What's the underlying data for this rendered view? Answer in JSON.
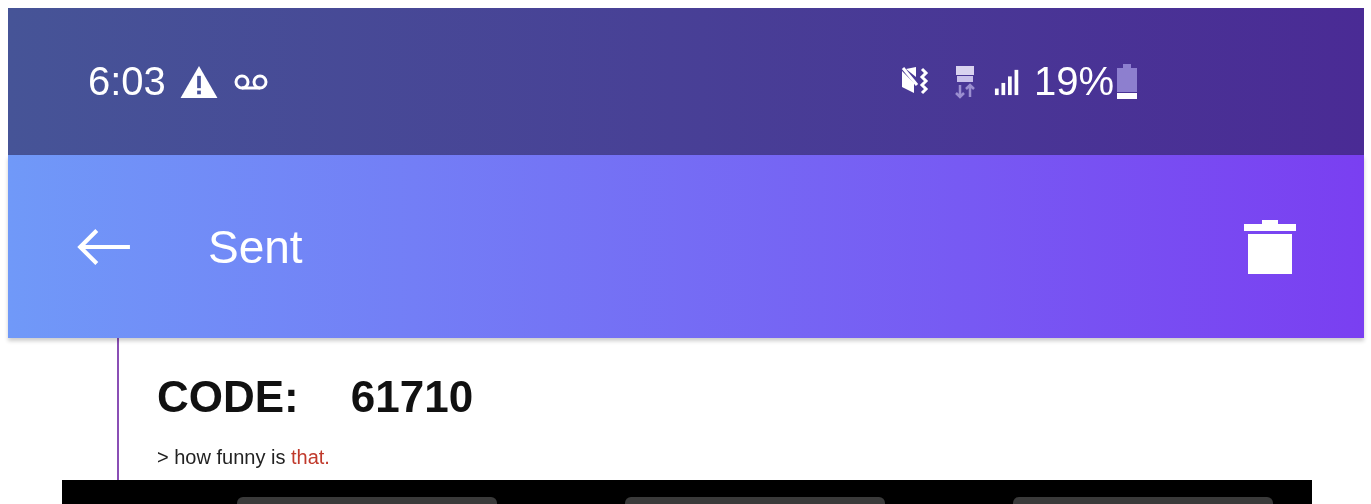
{
  "status_bar": {
    "time": "6:03",
    "battery": "19%"
  },
  "app_bar": {
    "title": "Sent"
  },
  "message": {
    "code_label": "CODE:",
    "code_value": "61710",
    "quote": {
      "text": "> how funny is ",
      "highlight": "that."
    }
  }
}
